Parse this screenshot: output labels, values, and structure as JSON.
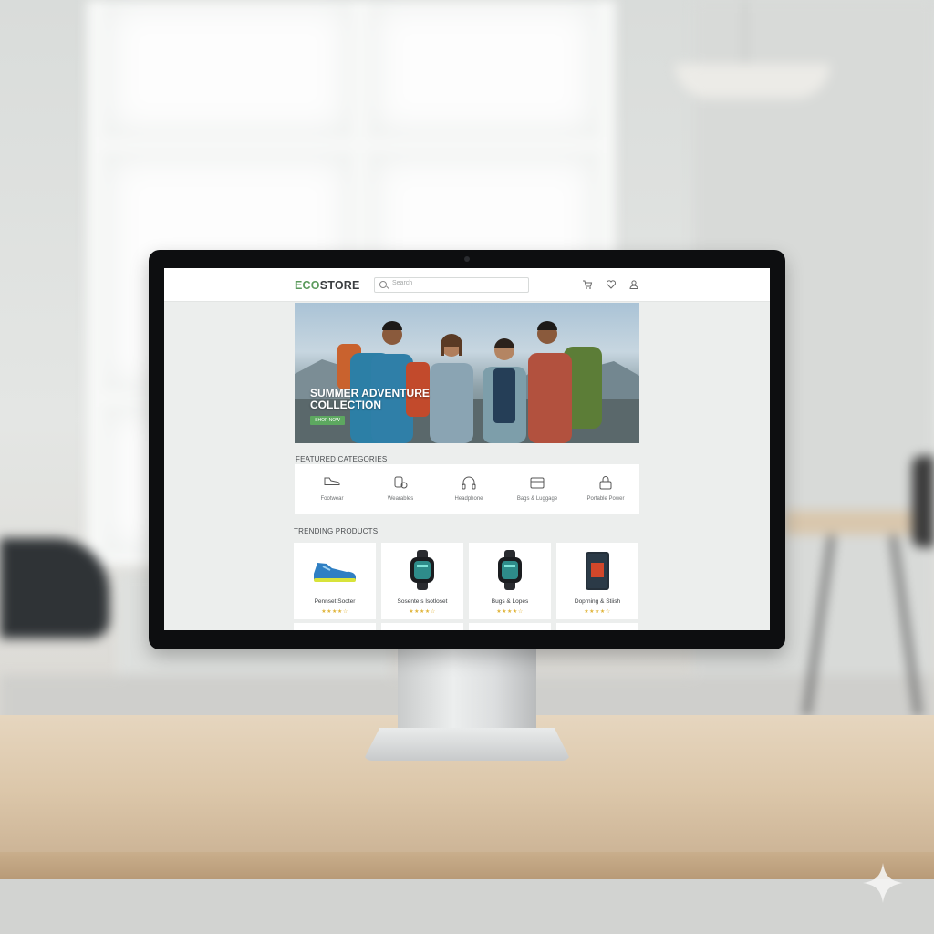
{
  "site": {
    "logo_prefix": "ECO",
    "logo_suffix": "STORE",
    "search_placeholder": "Search",
    "header_icons": [
      "cart-icon",
      "heart-icon",
      "user-icon"
    ]
  },
  "hero": {
    "title": "SUMMER ADVENTURE COLLECTION",
    "button_label": "SHOP NOW"
  },
  "featured": {
    "title": "FEATURED CATEGORIES",
    "items": [
      {
        "label": "Footwear",
        "icon": "shoe-icon"
      },
      {
        "label": "Wearables",
        "icon": "wearables-icon"
      },
      {
        "label": "Headphone",
        "icon": "headphone-icon"
      },
      {
        "label": "Bags & Luggage",
        "icon": "bag-icon"
      },
      {
        "label": "Portable Power",
        "icon": "lock-icon"
      }
    ]
  },
  "trending": {
    "title": "TRENDING PRODUCTS",
    "products": [
      {
        "name": "Pennset Sooter",
        "stars": "★★★★☆"
      },
      {
        "name": "Sosente s Isotloset",
        "stars": "★★★★☆"
      },
      {
        "name": "Bugs & Lopes",
        "stars": "★★★★☆"
      },
      {
        "name": "Doprning & Stiish",
        "stars": "★★★★☆"
      }
    ]
  },
  "colors": {
    "accent_green": "#5b9a5c",
    "star_gold": "#e0b43a",
    "bezel": "#0d0e10"
  }
}
